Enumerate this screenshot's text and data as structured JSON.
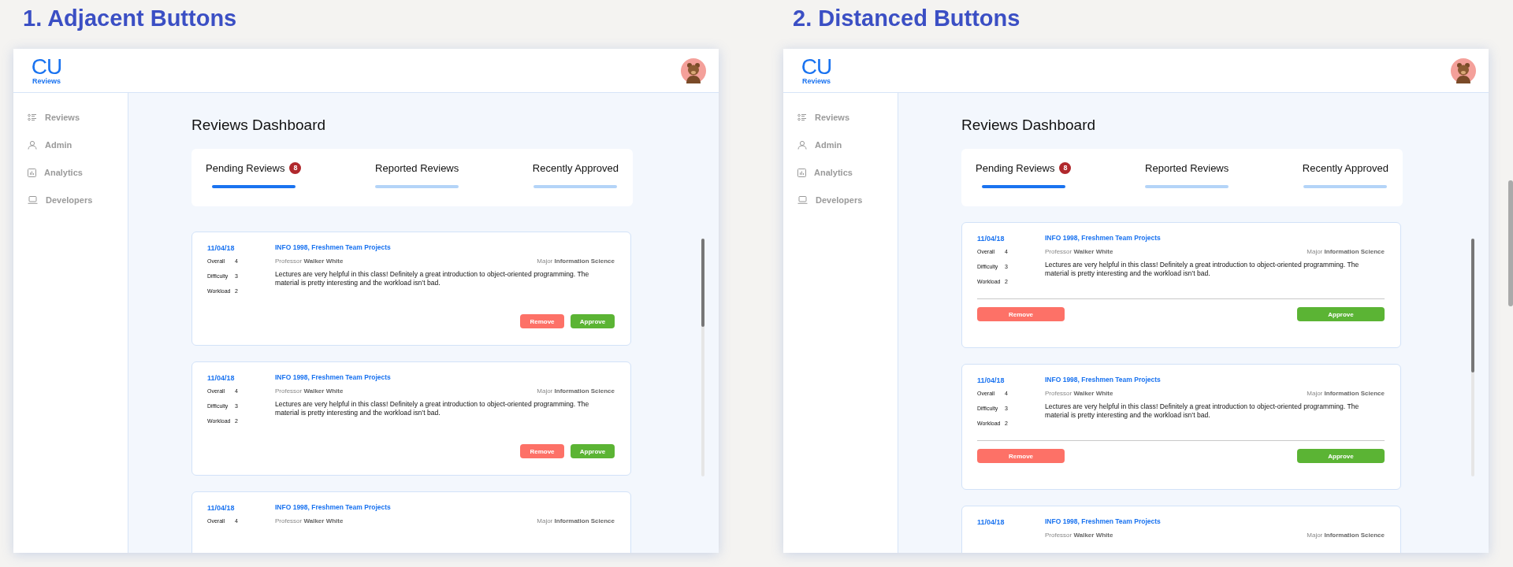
{
  "panels": [
    {
      "title": "1. Adjacent Buttons",
      "kind": "adjacent",
      "logo": {
        "mark": "CU",
        "name": "Reviews"
      },
      "nav": [
        {
          "label": "Reviews"
        },
        {
          "label": "Admin"
        },
        {
          "label": "Analytics"
        },
        {
          "label": "Developers"
        }
      ],
      "heading": "Reviews Dashboard",
      "tabs": [
        {
          "label": "Pending Reviews",
          "badge": "8",
          "selected": true
        },
        {
          "label": "Reported Reviews",
          "selected": false
        },
        {
          "label": "Recently Approved",
          "selected": false
        }
      ],
      "reviews": [
        {
          "date": "11/04/18",
          "course": "INFO 1998, Freshmen Team Projects",
          "professor": {
            "label": "Professor",
            "value": "Walker White"
          },
          "major": {
            "label": "Major",
            "value": "Information Science"
          },
          "ratings": [
            {
              "label": "Overall",
              "value": "4"
            },
            {
              "label": "Difficulty",
              "value": "3"
            },
            {
              "label": "Workload",
              "value": "2"
            }
          ],
          "body": "Lectures are very helpful in this class! Definitely a great introduction to object-oriented programming. The material is pretty interesting and the workload isn’t bad.",
          "actions": [
            {
              "label": "Remove",
              "kind": "remove"
            },
            {
              "label": "Approve",
              "kind": "approve"
            }
          ]
        },
        {
          "date": "11/04/18",
          "course": "INFO 1998, Freshmen Team Projects",
          "professor": {
            "label": "Professor",
            "value": "Walker White"
          },
          "major": {
            "label": "Major",
            "value": "Information Science"
          },
          "ratings": [
            {
              "label": "Overall",
              "value": "4"
            },
            {
              "label": "Difficulty",
              "value": "3"
            },
            {
              "label": "Workload",
              "value": "2"
            }
          ],
          "body": "Lectures are very helpful in this class! Definitely a great introduction to object-oriented programming. The material is pretty interesting and the workload isn’t bad.",
          "actions": [
            {
              "label": "Remove",
              "kind": "remove"
            },
            {
              "label": "Approve",
              "kind": "approve"
            }
          ]
        },
        {
          "date": "11/04/18",
          "course": "INFO 1998, Freshmen Team Projects",
          "professor": {
            "label": "Professor",
            "value": "Walker White"
          },
          "major": {
            "label": "Major",
            "value": "Information Science"
          },
          "ratings": [
            {
              "label": "Overall",
              "value": "4"
            }
          ]
        }
      ]
    },
    {
      "title": "2. Distanced Buttons",
      "kind": "distanced",
      "logo": {
        "mark": "CU",
        "name": "Reviews"
      },
      "nav": [
        {
          "label": "Reviews"
        },
        {
          "label": "Admin"
        },
        {
          "label": "Analytics"
        },
        {
          "label": "Developers"
        }
      ],
      "heading": "Reviews Dashboard",
      "tabs": [
        {
          "label": "Pending Reviews",
          "badge": "8",
          "selected": true
        },
        {
          "label": "Reported Reviews",
          "selected": false
        },
        {
          "label": "Recently Approved",
          "selected": false
        }
      ],
      "reviews": [
        {
          "date": "11/04/18",
          "course": "INFO 1998, Freshmen Team Projects",
          "professor": {
            "label": "Professor",
            "value": "Walker White"
          },
          "major": {
            "label": "Major",
            "value": "Information Science"
          },
          "ratings": [
            {
              "label": "Overall",
              "value": "4"
            },
            {
              "label": "Difficulty",
              "value": "3"
            },
            {
              "label": "Workload",
              "value": "2"
            }
          ],
          "body": "Lectures are very helpful in this class! Definitely a great introduction to object-oriented programming. The material is pretty interesting and the workload isn’t bad.",
          "actions": [
            {
              "label": "Remove",
              "kind": "remove"
            },
            {
              "label": "Approve",
              "kind": "approve"
            }
          ]
        },
        {
          "date": "11/04/18",
          "course": "INFO 1998, Freshmen Team Projects",
          "professor": {
            "label": "Professor",
            "value": "Walker White"
          },
          "major": {
            "label": "Major",
            "value": "Information Science"
          },
          "ratings": [
            {
              "label": "Overall",
              "value": "4"
            },
            {
              "label": "Difficulty",
              "value": "3"
            },
            {
              "label": "Workload",
              "value": "2"
            }
          ],
          "body": "Lectures are very helpful in this class! Definitely a great introduction to object-oriented programming. The material is pretty interesting and the workload isn’t bad.",
          "actions": [
            {
              "label": "Remove",
              "kind": "remove"
            },
            {
              "label": "Approve",
              "kind": "approve"
            }
          ]
        },
        {
          "date": "11/04/18",
          "course": "INFO 1998, Freshmen Team Projects",
          "professor": {
            "label": "Professor",
            "value": "Walker White"
          },
          "major": {
            "label": "Major",
            "value": "Information Science"
          }
        }
      ]
    }
  ]
}
